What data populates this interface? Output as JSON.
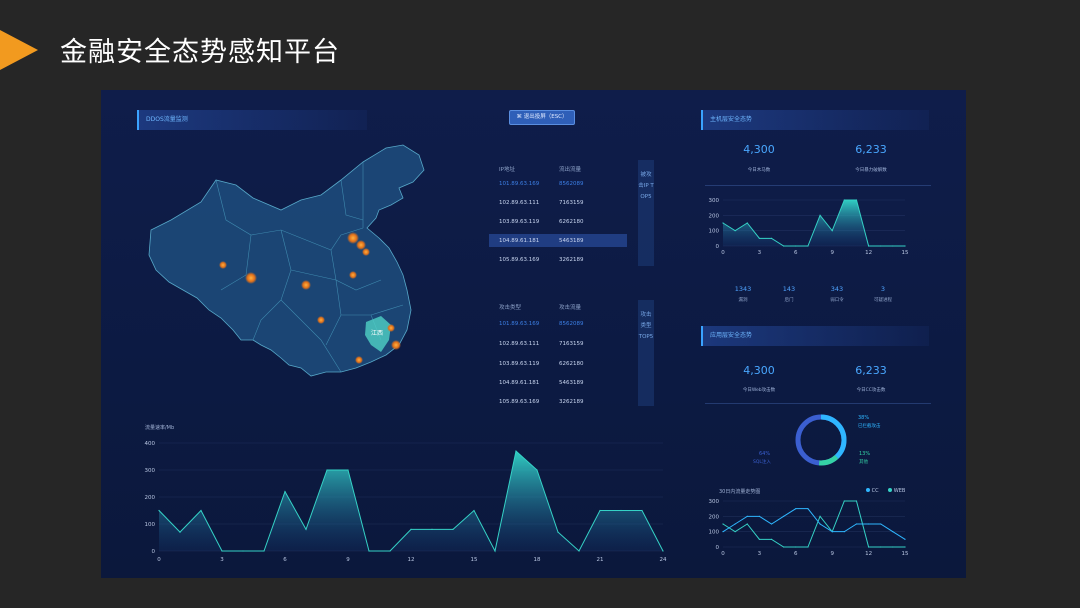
{
  "slide": {
    "title": "金融安全态势感知平台",
    "accent": "#f29a1f"
  },
  "dashboard": {
    "top_button": "⌘ 退出投屏（ESC）",
    "ddos_panel_title": "DDOS流量监测",
    "map_label": "江西",
    "table1": {
      "headers": [
        "IP地址",
        "流出流量"
      ],
      "rows": [
        [
          "101.89.63.169",
          "8562089"
        ],
        [
          "102.89.63.111",
          "7163159"
        ],
        [
          "103.89.63.119",
          "6262180"
        ],
        [
          "104.89.61.181",
          "5463189"
        ],
        [
          "105.89.63.169",
          "3262189"
        ]
      ],
      "tag": "被攻击IP TOP5"
    },
    "table2": {
      "headers": [
        "攻击类型",
        "攻击流量"
      ],
      "rows": [
        [
          "101.89.63.169",
          "8562089"
        ],
        [
          "102.89.63.111",
          "7163159"
        ],
        [
          "103.89.63.119",
          "6262180"
        ],
        [
          "104.89.61.181",
          "5463189"
        ],
        [
          "105.89.63.169",
          "3262189"
        ]
      ],
      "tag": "攻击类型 TOP5"
    },
    "host_panel": {
      "title": "主机层安全态势",
      "stats": [
        {
          "value": "4,300",
          "label": "今日木马数"
        },
        {
          "value": "6,233",
          "label": "今日暴力破解数"
        }
      ],
      "mini_stats": [
        {
          "value": "1343",
          "label": "漏洞"
        },
        {
          "value": "143",
          "label": "后门"
        },
        {
          "value": "343",
          "label": "弱口令"
        },
        {
          "value": "3",
          "label": "可疑进程"
        }
      ]
    },
    "app_panel": {
      "title": "应用层安全态势",
      "stats": [
        {
          "value": "4,300",
          "label": "今日Web攻击数"
        },
        {
          "value": "6,233",
          "label": "今日CC攻击数"
        }
      ],
      "donut": [
        {
          "pct": "38%",
          "label": "已拦截攻击",
          "color": "#2fb6ff"
        },
        {
          "pct": "64%",
          "label": "SQL注入",
          "color": "#3b5fd0"
        },
        {
          "pct": "13%",
          "label": "其他",
          "color": "#35d2a6"
        }
      ],
      "trend_title": "30日内流量走势图",
      "legend": [
        {
          "name": "CC",
          "color": "#2fb6ff"
        },
        {
          "name": "WEB",
          "color": "#35d2c6"
        }
      ]
    }
  },
  "chart_data": [
    {
      "type": "area",
      "title": "流量速率/Mb",
      "x": [
        0,
        1,
        2,
        3,
        4,
        5,
        6,
        7,
        8,
        9,
        10,
        11,
        12,
        13,
        14,
        15,
        16,
        17,
        18,
        19,
        20,
        21,
        22,
        23,
        24
      ],
      "values": [
        150,
        70,
        150,
        0,
        0,
        0,
        220,
        80,
        300,
        300,
        0,
        0,
        80,
        80,
        80,
        150,
        0,
        370,
        300,
        70,
        0,
        150,
        150,
        150,
        0
      ],
      "ylim": [
        0,
        400
      ],
      "yticks": [
        0,
        100,
        200,
        300,
        400
      ],
      "xticks": [
        0,
        3,
        6,
        9,
        12,
        15,
        18,
        21,
        24
      ]
    },
    {
      "type": "area",
      "x": [
        0,
        1,
        2,
        3,
        4,
        5,
        6,
        7,
        8,
        9,
        10,
        11,
        12,
        13,
        14,
        15
      ],
      "values": [
        150,
        100,
        150,
        50,
        50,
        0,
        0,
        0,
        200,
        100,
        300,
        300,
        0,
        0,
        0,
        0
      ],
      "ylim": [
        0,
        300
      ],
      "yticks": [
        0,
        100,
        200,
        300
      ],
      "xticks": [
        0,
        3,
        6,
        9,
        12,
        15
      ]
    },
    {
      "type": "line",
      "x": [
        0,
        1,
        2,
        3,
        4,
        5,
        6,
        7,
        8,
        9,
        10,
        11,
        12,
        13,
        14,
        15
      ],
      "series": [
        {
          "name": "CC",
          "values": [
            150,
            100,
            150,
            50,
            50,
            0,
            0,
            0,
            200,
            100,
            300,
            300,
            0,
            0,
            0,
            0
          ]
        },
        {
          "name": "WEB",
          "values": [
            100,
            150,
            200,
            200,
            150,
            200,
            250,
            250,
            150,
            100,
            100,
            150,
            150,
            150,
            100,
            50
          ]
        }
      ],
      "ylim": [
        0,
        300
      ],
      "yticks": [
        0,
        100,
        200,
        300
      ],
      "xticks": [
        0,
        3,
        6,
        9,
        12,
        15
      ]
    }
  ]
}
